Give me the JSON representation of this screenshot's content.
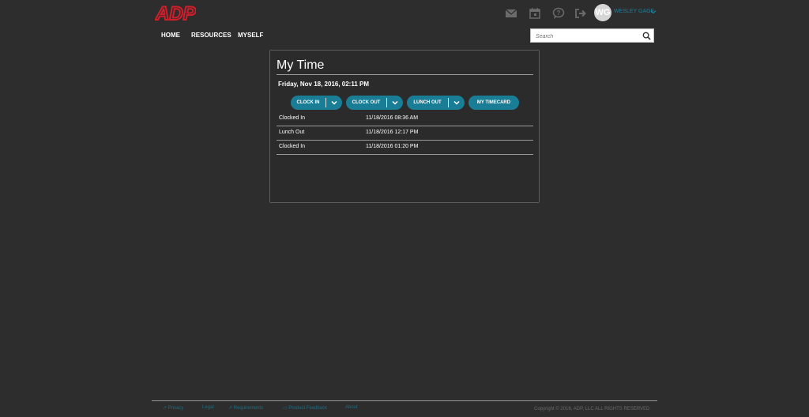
{
  "brand": {
    "logo_text": "ADP",
    "logo_color": "#d01e2a",
    "accent": "#1a7d96"
  },
  "header": {
    "icons": [
      "mail-icon",
      "calendar-icon",
      "help-icon",
      "sign-out-icon"
    ],
    "user": {
      "initials": "WG",
      "name": "WESLEY GAGE"
    }
  },
  "nav": {
    "items": [
      "HOME",
      "RESOURCES",
      "MYSELF"
    ]
  },
  "search": {
    "placeholder": "Search"
  },
  "card": {
    "title": "My Time",
    "date": "Friday, Nov 18, 2016, 02:11 PM",
    "buttons": {
      "clock_in": "CLOCK IN",
      "clock_out": "CLOCK OUT",
      "lunch_out": "LUNCH OUT",
      "my_timecard": "MY TIMECARD"
    },
    "entries": [
      {
        "label": "Clocked In",
        "time": "11/18/2016 08:36 AM"
      },
      {
        "label": "Lunch Out",
        "time": "11/18/2016 12:17 PM"
      },
      {
        "label": "Clocked In",
        "time": "11/18/2016 01:20 PM"
      }
    ]
  },
  "footer": {
    "links": [
      "Privacy",
      "Legal",
      "Requirements",
      "Product Feedback",
      "About"
    ],
    "copyright": "Copyright © 2016, ADP, LLC ALL RIGHTS RESERVED"
  }
}
